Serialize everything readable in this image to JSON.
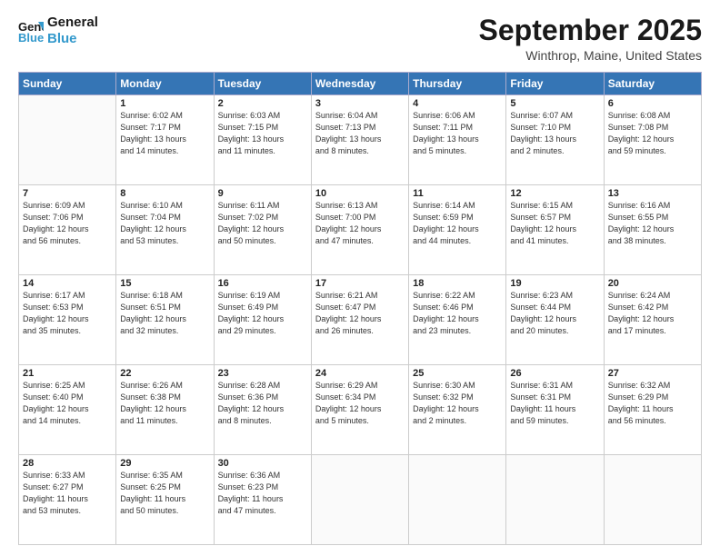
{
  "header": {
    "logo_line1": "General",
    "logo_line2": "Blue",
    "month_title": "September 2025",
    "location": "Winthrop, Maine, United States"
  },
  "days_of_week": [
    "Sunday",
    "Monday",
    "Tuesday",
    "Wednesday",
    "Thursday",
    "Friday",
    "Saturday"
  ],
  "weeks": [
    [
      {
        "day": "",
        "info": ""
      },
      {
        "day": "1",
        "info": "Sunrise: 6:02 AM\nSunset: 7:17 PM\nDaylight: 13 hours\nand 14 minutes."
      },
      {
        "day": "2",
        "info": "Sunrise: 6:03 AM\nSunset: 7:15 PM\nDaylight: 13 hours\nand 11 minutes."
      },
      {
        "day": "3",
        "info": "Sunrise: 6:04 AM\nSunset: 7:13 PM\nDaylight: 13 hours\nand 8 minutes."
      },
      {
        "day": "4",
        "info": "Sunrise: 6:06 AM\nSunset: 7:11 PM\nDaylight: 13 hours\nand 5 minutes."
      },
      {
        "day": "5",
        "info": "Sunrise: 6:07 AM\nSunset: 7:10 PM\nDaylight: 13 hours\nand 2 minutes."
      },
      {
        "day": "6",
        "info": "Sunrise: 6:08 AM\nSunset: 7:08 PM\nDaylight: 12 hours\nand 59 minutes."
      }
    ],
    [
      {
        "day": "7",
        "info": "Sunrise: 6:09 AM\nSunset: 7:06 PM\nDaylight: 12 hours\nand 56 minutes."
      },
      {
        "day": "8",
        "info": "Sunrise: 6:10 AM\nSunset: 7:04 PM\nDaylight: 12 hours\nand 53 minutes."
      },
      {
        "day": "9",
        "info": "Sunrise: 6:11 AM\nSunset: 7:02 PM\nDaylight: 12 hours\nand 50 minutes."
      },
      {
        "day": "10",
        "info": "Sunrise: 6:13 AM\nSunset: 7:00 PM\nDaylight: 12 hours\nand 47 minutes."
      },
      {
        "day": "11",
        "info": "Sunrise: 6:14 AM\nSunset: 6:59 PM\nDaylight: 12 hours\nand 44 minutes."
      },
      {
        "day": "12",
        "info": "Sunrise: 6:15 AM\nSunset: 6:57 PM\nDaylight: 12 hours\nand 41 minutes."
      },
      {
        "day": "13",
        "info": "Sunrise: 6:16 AM\nSunset: 6:55 PM\nDaylight: 12 hours\nand 38 minutes."
      }
    ],
    [
      {
        "day": "14",
        "info": "Sunrise: 6:17 AM\nSunset: 6:53 PM\nDaylight: 12 hours\nand 35 minutes."
      },
      {
        "day": "15",
        "info": "Sunrise: 6:18 AM\nSunset: 6:51 PM\nDaylight: 12 hours\nand 32 minutes."
      },
      {
        "day": "16",
        "info": "Sunrise: 6:19 AM\nSunset: 6:49 PM\nDaylight: 12 hours\nand 29 minutes."
      },
      {
        "day": "17",
        "info": "Sunrise: 6:21 AM\nSunset: 6:47 PM\nDaylight: 12 hours\nand 26 minutes."
      },
      {
        "day": "18",
        "info": "Sunrise: 6:22 AM\nSunset: 6:46 PM\nDaylight: 12 hours\nand 23 minutes."
      },
      {
        "day": "19",
        "info": "Sunrise: 6:23 AM\nSunset: 6:44 PM\nDaylight: 12 hours\nand 20 minutes."
      },
      {
        "day": "20",
        "info": "Sunrise: 6:24 AM\nSunset: 6:42 PM\nDaylight: 12 hours\nand 17 minutes."
      }
    ],
    [
      {
        "day": "21",
        "info": "Sunrise: 6:25 AM\nSunset: 6:40 PM\nDaylight: 12 hours\nand 14 minutes."
      },
      {
        "day": "22",
        "info": "Sunrise: 6:26 AM\nSunset: 6:38 PM\nDaylight: 12 hours\nand 11 minutes."
      },
      {
        "day": "23",
        "info": "Sunrise: 6:28 AM\nSunset: 6:36 PM\nDaylight: 12 hours\nand 8 minutes."
      },
      {
        "day": "24",
        "info": "Sunrise: 6:29 AM\nSunset: 6:34 PM\nDaylight: 12 hours\nand 5 minutes."
      },
      {
        "day": "25",
        "info": "Sunrise: 6:30 AM\nSunset: 6:32 PM\nDaylight: 12 hours\nand 2 minutes."
      },
      {
        "day": "26",
        "info": "Sunrise: 6:31 AM\nSunset: 6:31 PM\nDaylight: 11 hours\nand 59 minutes."
      },
      {
        "day": "27",
        "info": "Sunrise: 6:32 AM\nSunset: 6:29 PM\nDaylight: 11 hours\nand 56 minutes."
      }
    ],
    [
      {
        "day": "28",
        "info": "Sunrise: 6:33 AM\nSunset: 6:27 PM\nDaylight: 11 hours\nand 53 minutes."
      },
      {
        "day": "29",
        "info": "Sunrise: 6:35 AM\nSunset: 6:25 PM\nDaylight: 11 hours\nand 50 minutes."
      },
      {
        "day": "30",
        "info": "Sunrise: 6:36 AM\nSunset: 6:23 PM\nDaylight: 11 hours\nand 47 minutes."
      },
      {
        "day": "",
        "info": ""
      },
      {
        "day": "",
        "info": ""
      },
      {
        "day": "",
        "info": ""
      },
      {
        "day": "",
        "info": ""
      }
    ]
  ]
}
